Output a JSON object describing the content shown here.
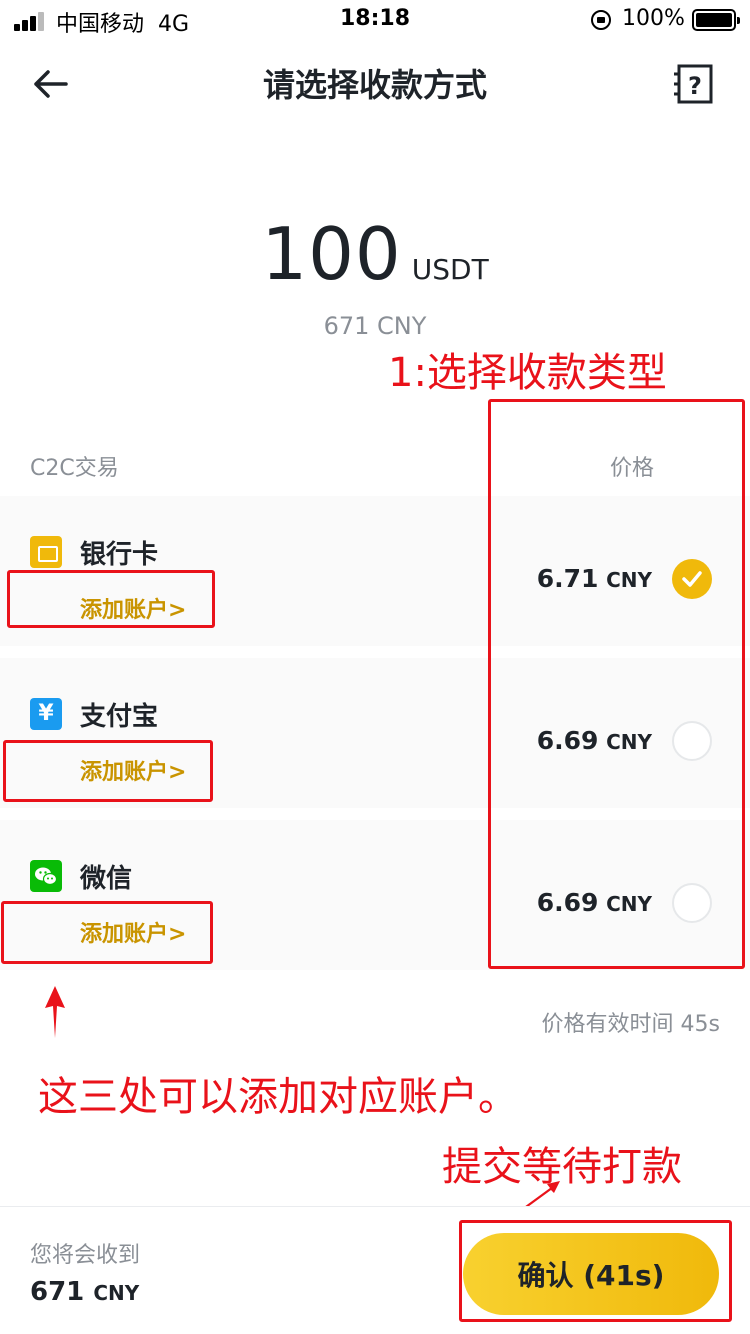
{
  "status_bar": {
    "carrier": "中国移动",
    "network": "4G",
    "time": "18:18",
    "battery": "100%"
  },
  "nav": {
    "title": "请选择收款方式"
  },
  "amount": {
    "value": "100",
    "unit": "USDT",
    "cny": "671 CNY"
  },
  "section": {
    "left_label": "C2C交易",
    "right_label": "价格"
  },
  "payments": [
    {
      "name": "银行卡",
      "add_label": "添加账户>",
      "price": "6.71",
      "currency": "CNY",
      "selected": true
    },
    {
      "name": "支付宝",
      "add_label": "添加账户>",
      "price": "6.69",
      "currency": "CNY",
      "selected": false
    },
    {
      "name": "微信",
      "add_label": "添加账户>",
      "price": "6.69",
      "currency": "CNY",
      "selected": false
    }
  ],
  "alipay_glyph": "¥",
  "valid_time": "价格有效时间 45s",
  "annotations": {
    "select_type": "1:选择收款类型",
    "add_accounts": "这三处可以添加对应账户。",
    "submit": "提交等待打款"
  },
  "bottom": {
    "receive_label": "您将会收到",
    "receive_value": "671",
    "receive_unit": "CNY",
    "confirm_label": "确认 (41s)"
  },
  "colors": {
    "accent": "#f0b90b",
    "add_link": "#c99400",
    "annotation": "#e9121a"
  },
  "icons": [
    "signal-icon",
    "lock-rotation-icon",
    "battery-icon",
    "back-arrow-icon",
    "help-icon",
    "bank-card-icon",
    "alipay-icon",
    "wechat-icon",
    "check-icon"
  ]
}
